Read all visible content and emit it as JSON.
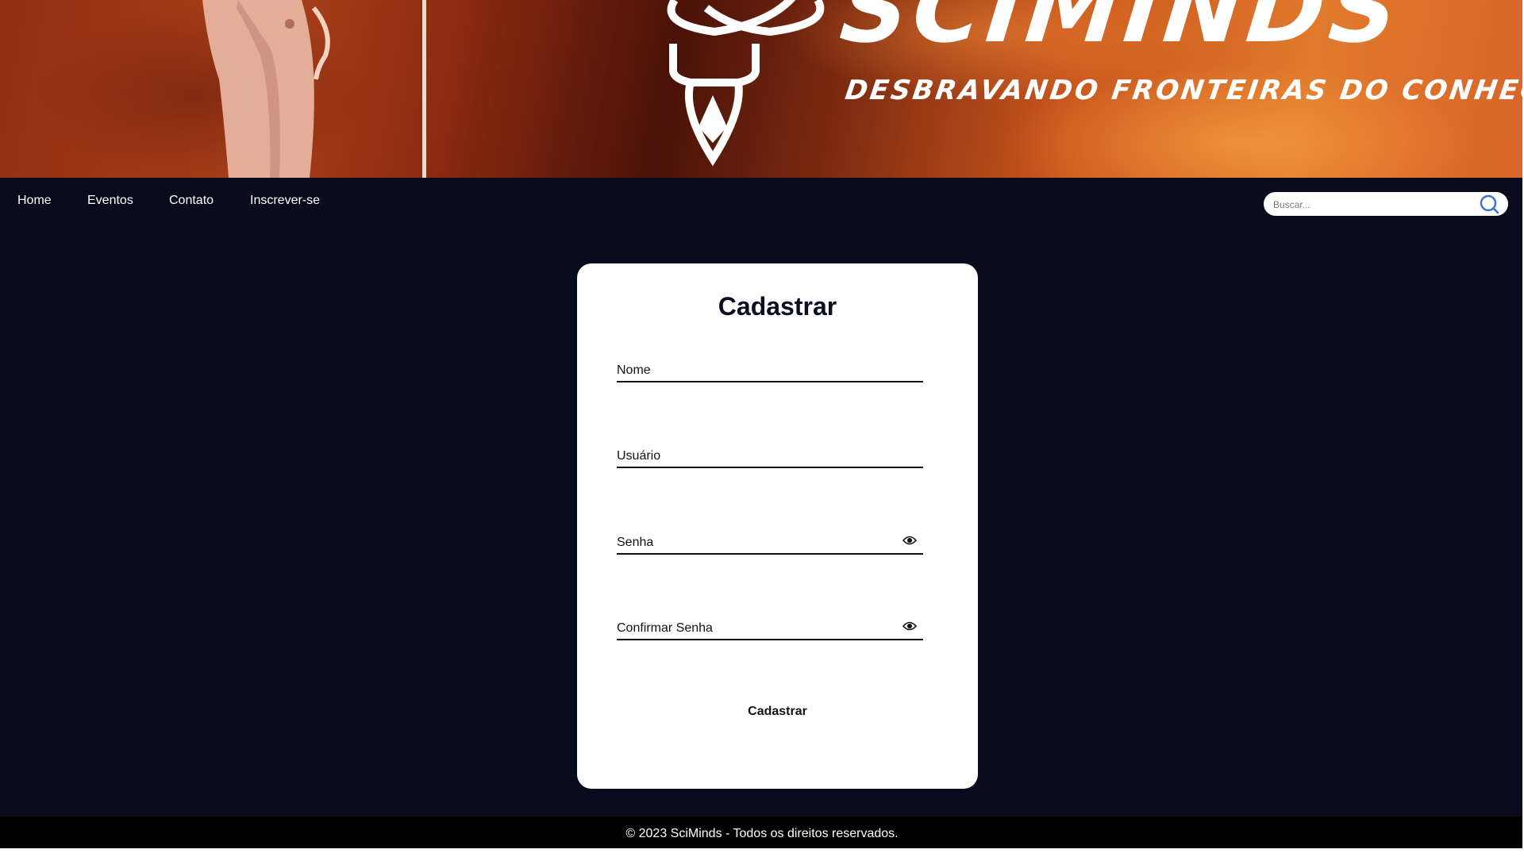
{
  "banner": {
    "brand_name": "SCIMINDS",
    "tagline": "DESBRAVANDO FRONTEIRAS DO CONHECIMENTO"
  },
  "nav": {
    "items": [
      {
        "label": "Home"
      },
      {
        "label": "Eventos"
      },
      {
        "label": "Contato"
      },
      {
        "label": "Inscrever-se"
      }
    ]
  },
  "search": {
    "placeholder": "Buscar...",
    "value": "",
    "icon": "search-icon"
  },
  "form": {
    "title": "Cadastrar",
    "fields": [
      {
        "label": "Nome",
        "value": ""
      },
      {
        "label": "Usuário",
        "value": ""
      },
      {
        "label": "Senha",
        "value": "",
        "icon": "eye-icon"
      },
      {
        "label": "Confirmar Senha",
        "value": "",
        "icon": "eye-icon"
      }
    ],
    "submit_label": "Cadastrar"
  },
  "footer": {
    "text": "© 2023 SciMinds - Todos os direitos reservados."
  },
  "colors": {
    "page_background": "#070b1b",
    "card_background": "#ffffff",
    "footer_background": "#000000",
    "search_icon": "#3a6fd8",
    "banner_accent": "#d9652a"
  }
}
